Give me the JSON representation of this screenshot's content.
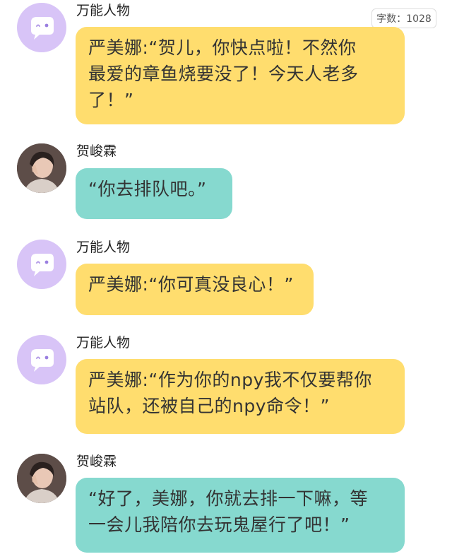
{
  "word_count": "字数：1028",
  "messages": [
    {
      "sender": "万能人物",
      "avatar": "ghost-icon",
      "bubble_color": "#ffdd6e",
      "lines": [
        "严美娜:“贺儿，你快点啦！不然你",
        "最爱的章鱼烧要没了！今天人老多",
        "了！”"
      ]
    },
    {
      "sender": "贺峻霖",
      "avatar": "profile-photo",
      "bubble_color": "#86d9cf",
      "lines": [
        "“你去排队吧。”"
      ]
    },
    {
      "sender": "万能人物",
      "avatar": "ghost-icon",
      "bubble_color": "#ffdd6e",
      "lines": [
        "严美娜:“你可真没良心！”"
      ]
    },
    {
      "sender": "万能人物",
      "avatar": "ghost-icon",
      "bubble_color": "#ffdd6e",
      "lines": [
        "严美娜:“作为你的npy我不仅要帮你",
        "站队，还被自己的npy命令！”"
      ]
    },
    {
      "sender": "贺峻霖",
      "avatar": "profile-photo",
      "bubble_color": "#86d9cf",
      "lines": [
        "“好了，美娜，你就去排一下嘛，等",
        "一会儿我陪你去玩鬼屋行了吧！”"
      ]
    }
  ]
}
